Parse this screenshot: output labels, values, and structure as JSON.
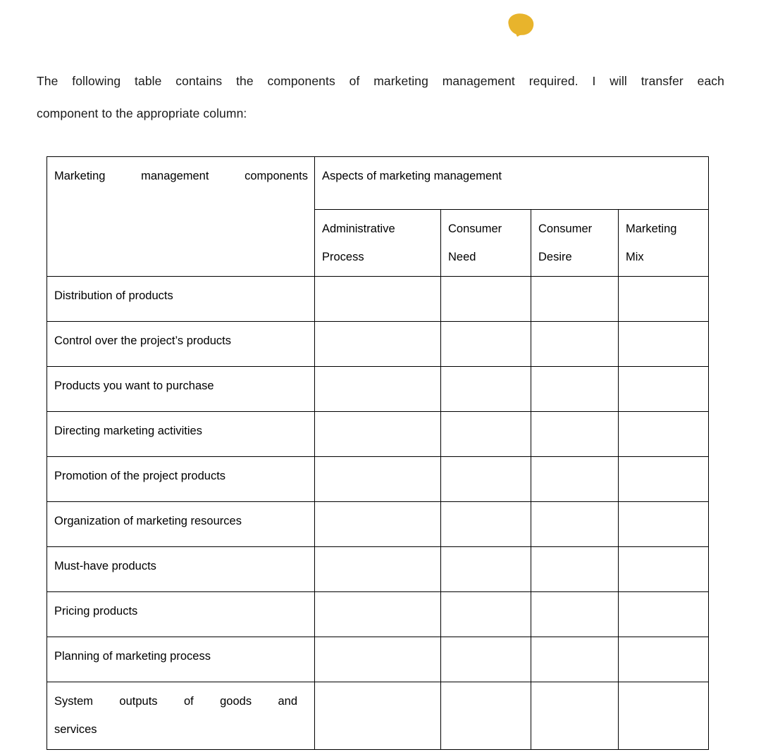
{
  "document": {
    "decoration": {
      "name": "amber-blob",
      "color": "#e8b42c"
    },
    "intro": {
      "line1": "The following table contains the components of marketing management required. I will transfer each",
      "line2": "component to the appropriate column:"
    },
    "table": {
      "header": {
        "components_column": "Marketing management components",
        "aspects_group": "Aspects of marketing management",
        "sub_columns": [
          {
            "line1": "Administrative",
            "line2": "Process"
          },
          {
            "line1": "Consumer",
            "line2": "Need"
          },
          {
            "line1": "Consumer",
            "line2": "Desire"
          },
          {
            "line1": "Marketing",
            "line2": "Mix"
          }
        ]
      },
      "rows": [
        {
          "label": "Distribution of products",
          "wrapped": false,
          "line1": "",
          "line2": "",
          "size": "short"
        },
        {
          "label": "Control over the project’s products",
          "wrapped": false,
          "line1": "",
          "line2": "",
          "size": "normal"
        },
        {
          "label": "Products you want to purchase",
          "wrapped": false,
          "line1": "",
          "line2": "",
          "size": "normal"
        },
        {
          "label": "Directing marketing activities",
          "wrapped": false,
          "line1": "",
          "line2": "",
          "size": "normal"
        },
        {
          "label": "Promotion of the project products",
          "wrapped": false,
          "line1": "",
          "line2": "",
          "size": "normal"
        },
        {
          "label": "Organization of marketing resources",
          "wrapped": false,
          "line1": "",
          "line2": "",
          "size": "normal"
        },
        {
          "label": "Must-have products",
          "wrapped": false,
          "line1": "",
          "line2": "",
          "size": "normal"
        },
        {
          "label": "Pricing products",
          "wrapped": false,
          "line1": "",
          "line2": "",
          "size": "normal"
        },
        {
          "label": "Planning of marketing process",
          "wrapped": false,
          "line1": "",
          "line2": "",
          "size": "normal"
        },
        {
          "label": "System outputs of goods and services",
          "wrapped": true,
          "line1": "System outputs of goods and",
          "line2": "services",
          "size": "tall"
        }
      ],
      "cell_values": [
        [
          "",
          "",
          "",
          ""
        ],
        [
          "",
          "",
          "",
          ""
        ],
        [
          "",
          "",
          "",
          ""
        ],
        [
          "",
          "",
          "",
          ""
        ],
        [
          "",
          "",
          "",
          ""
        ],
        [
          "",
          "",
          "",
          ""
        ],
        [
          "",
          "",
          "",
          ""
        ],
        [
          "",
          "",
          "",
          ""
        ],
        [
          "",
          "",
          "",
          ""
        ],
        [
          "",
          "",
          "",
          ""
        ]
      ]
    }
  }
}
